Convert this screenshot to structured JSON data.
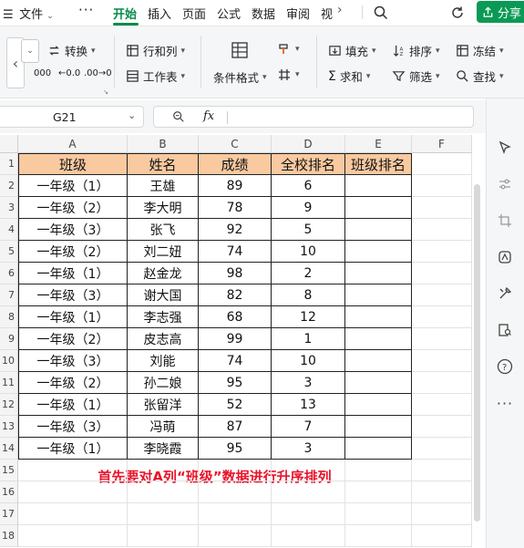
{
  "menubar": {
    "file": "文件",
    "tabs": [
      "开始",
      "插入",
      "页面",
      "公式",
      "数据",
      "审阅",
      "视"
    ],
    "share": "分享"
  },
  "ribbon": {
    "convert": "转换",
    "rows_cols": "行和列",
    "worksheet": "工作表",
    "cond_format": "条件格式",
    "fill": "填充",
    "sort": "排序",
    "freeze": "冻结",
    "sum": "求和",
    "filter": "筛选",
    "find": "查找",
    "num_btn1": "000",
    "num_btn2": "←0.0",
    "num_btn3": ".00→0"
  },
  "formula_bar": {
    "cell_ref": "G21",
    "fx": "fx",
    "formula": ""
  },
  "sheet": {
    "columns": [
      "A",
      "B",
      "C",
      "D",
      "E",
      "F"
    ],
    "rows": [
      "1",
      "2",
      "3",
      "4",
      "5",
      "6",
      "7",
      "8",
      "9",
      "10",
      "11",
      "12",
      "13",
      "14",
      "15",
      "16",
      "17",
      "18"
    ],
    "headers": [
      "班级",
      "姓名",
      "成绩",
      "全校排名",
      "班级排名"
    ],
    "data": [
      [
        "一年级（1）",
        "王雄",
        "89",
        "6",
        ""
      ],
      [
        "一年级（2）",
        "李大明",
        "78",
        "9",
        ""
      ],
      [
        "一年级（3）",
        "张飞",
        "92",
        "5",
        ""
      ],
      [
        "一年级（2）",
        "刘二妞",
        "74",
        "10",
        ""
      ],
      [
        "一年级（1）",
        "赵金龙",
        "98",
        "2",
        ""
      ],
      [
        "一年级（3）",
        "谢大国",
        "82",
        "8",
        ""
      ],
      [
        "一年级（1）",
        "李志强",
        "68",
        "12",
        ""
      ],
      [
        "一年级（2）",
        "皮志高",
        "99",
        "1",
        ""
      ],
      [
        "一年级（3）",
        "刘能",
        "74",
        "10",
        ""
      ],
      [
        "一年级（2）",
        "孙二娘",
        "95",
        "3",
        ""
      ],
      [
        "一年级（1）",
        "张留洋",
        "52",
        "13",
        ""
      ],
      [
        "一年级（3）",
        "冯萌",
        "87",
        "7",
        ""
      ],
      [
        "一年级（1）",
        "李晓霞",
        "95",
        "3",
        ""
      ]
    ],
    "note": "首先要对A列“班级”数据进行升序排列"
  },
  "colors": {
    "accent": "#0a8a4a",
    "header_fill": "#f9c9a0",
    "note_red": "#e8142b"
  }
}
